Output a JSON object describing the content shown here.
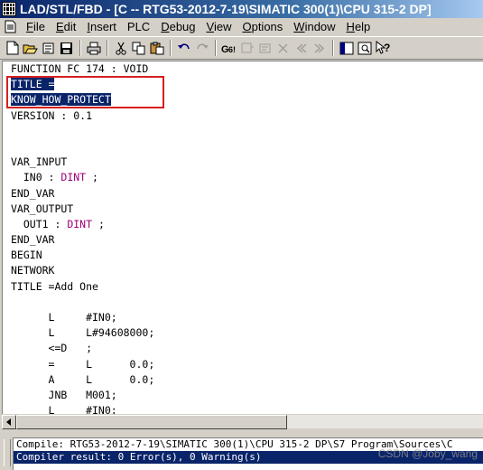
{
  "titlebar": {
    "title": "LAD/STL/FBD  - [C -- RTG53-2012-7-19\\SIMATIC 300(1)\\CPU 315-2 DP]"
  },
  "menu": [
    {
      "label": "File",
      "accel": "F",
      "rest": "ile"
    },
    {
      "label": "Edit",
      "accel": "E",
      "rest": "dit"
    },
    {
      "label": "Insert",
      "accel": "I",
      "rest": "nsert"
    },
    {
      "label": "PLC",
      "accel": "",
      "rest": "PLC"
    },
    {
      "label": "Debug",
      "accel": "D",
      "rest": "ebug"
    },
    {
      "label": "View",
      "accel": "V",
      "rest": "iew"
    },
    {
      "label": "Options",
      "accel": "O",
      "rest": "ptions"
    },
    {
      "label": "Window",
      "accel": "W",
      "rest": "indow"
    },
    {
      "label": "Help",
      "accel": "H",
      "rest": "elp"
    }
  ],
  "toolbar_icons": [
    "new-icon",
    "open-icon",
    "network-icon",
    "save-icon",
    "print-icon",
    "cut-icon",
    "copy-icon",
    "paste-icon",
    "undo-icon",
    "redo-icon",
    "online-icon",
    "monitor-icon",
    "open-block-icon",
    "delete-icon",
    "prev-icon",
    "next-icon",
    "overview-icon",
    "details-icon",
    "whats-this-icon"
  ],
  "editor": {
    "lines": [
      {
        "text": "FUNCTION FC 174 : VOID"
      },
      {
        "text": "TITLE =",
        "selected": true
      },
      {
        "text": "KNOW_HOW_PROTECT",
        "selected": true
      },
      {
        "text": "VERSION : 0.1"
      },
      {
        "text": ""
      },
      {
        "text": ""
      },
      {
        "text": "VAR_INPUT"
      },
      {
        "pre": "  IN0 : ",
        "type": "DINT",
        "post": " ;"
      },
      {
        "text": "END_VAR"
      },
      {
        "text": "VAR_OUTPUT"
      },
      {
        "pre": "  OUT1 : ",
        "type": "DINT",
        "post": " ;"
      },
      {
        "text": "END_VAR"
      },
      {
        "text": "BEGIN"
      },
      {
        "text": "NETWORK"
      },
      {
        "text": "TITLE =Add One"
      },
      {
        "text": ""
      },
      {
        "text": "      L     #IN0;"
      },
      {
        "text": "      L     L#94608000;"
      },
      {
        "text": "      <=D   ;"
      },
      {
        "text": "      =     L      0.0;"
      },
      {
        "text": "      A     L      0.0;"
      },
      {
        "text": "      JNB   M001;"
      },
      {
        "text": "      L     #IN0;"
      }
    ]
  },
  "output": {
    "compile_line": "Compile: RTG53-2012-7-19\\SIMATIC 300(1)\\CPU 315-2 DP\\S7 Program\\Sources\\C",
    "result_line": "Compiler result: 0 Error(s), 0 Warning(s)"
  },
  "watermark": "CSDN @Joby_wang"
}
